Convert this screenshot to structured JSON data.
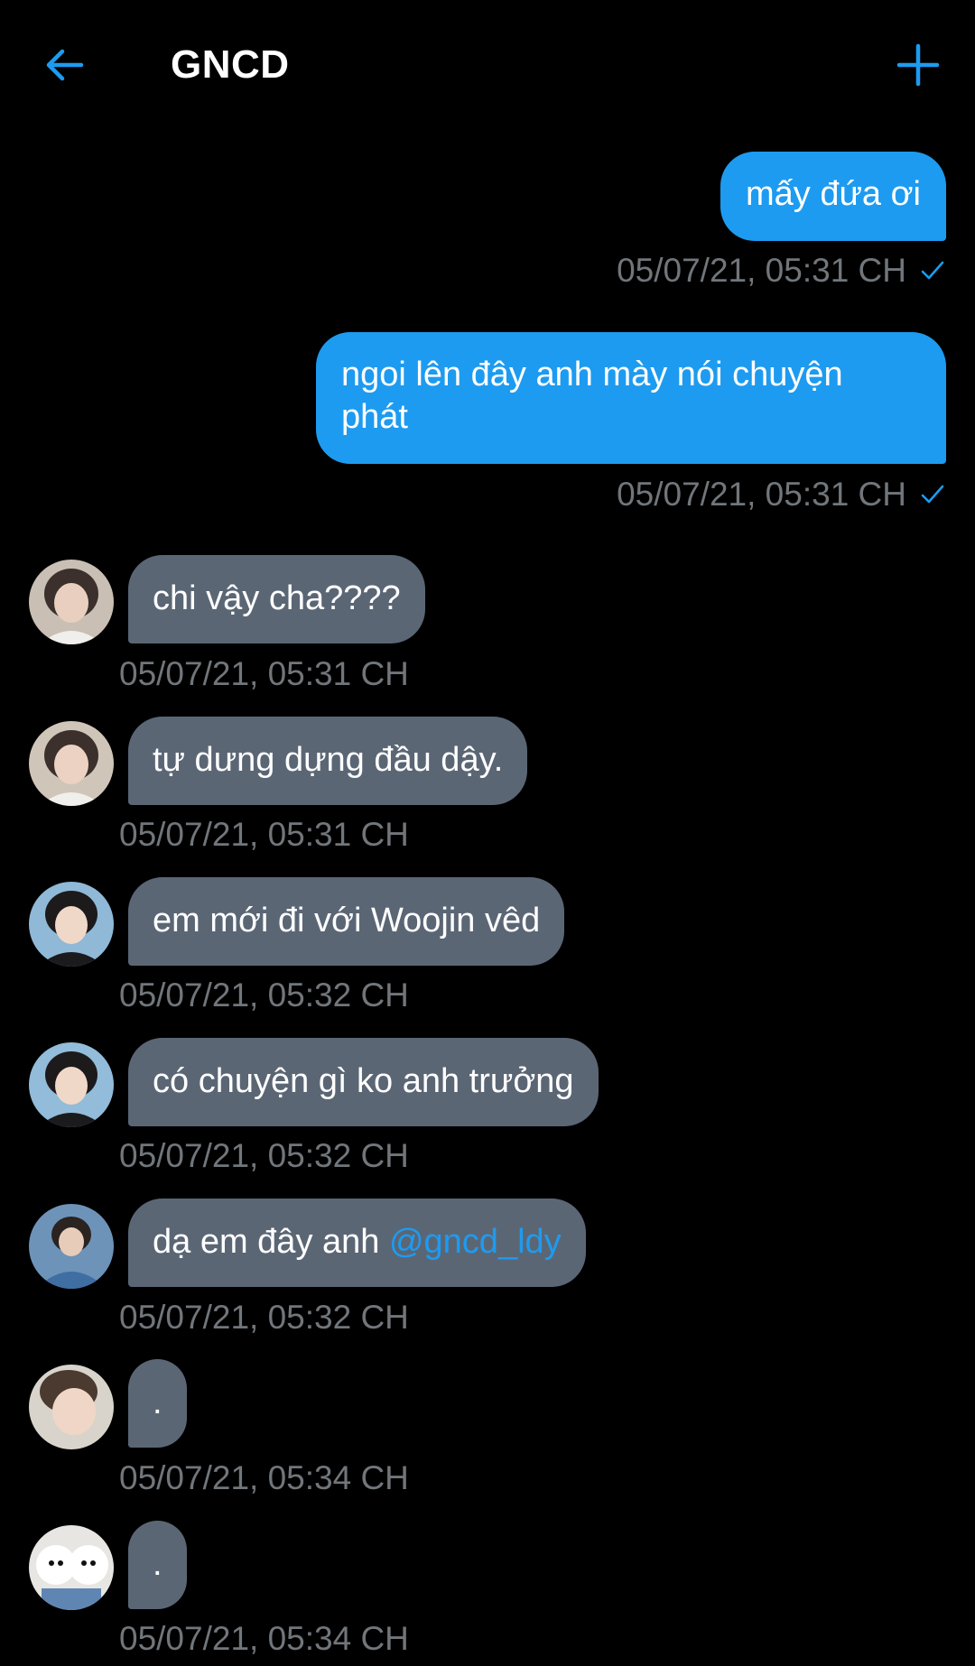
{
  "header": {
    "title": "GNCD",
    "back_icon": "arrow-left-icon",
    "add_icon": "plus-icon",
    "accent": "#1d9bf0"
  },
  "messages": [
    {
      "direction": "out",
      "text": "mấy đứa ơi",
      "time": "05/07/21, 05:31 CH",
      "status_icon": "check-icon"
    },
    {
      "direction": "out",
      "text_line1": "ngoi lên đây anh mày nói chuyện",
      "text_line2": "phát",
      "time": "05/07/21, 05:31 CH",
      "status_icon": "check-icon"
    },
    {
      "direction": "in",
      "text": "chi vậy cha????",
      "time": "05/07/21, 05:31 CH",
      "avatar": "avatar-boy-white-shirt"
    },
    {
      "direction": "in",
      "text": "tự dưng dựng đầu dậy.",
      "time": "05/07/21, 05:31 CH",
      "avatar": "avatar-boy-white-shirt"
    },
    {
      "direction": "in",
      "text": "em mới đi với Woojin vêd",
      "time": "05/07/21, 05:32 CH",
      "avatar": "avatar-boy-dark-jacket"
    },
    {
      "direction": "in",
      "text": "có chuyện gì ko anh trưởng",
      "time": "05/07/21, 05:32 CH",
      "avatar": "avatar-boy-dark-jacket"
    },
    {
      "direction": "in",
      "text_prefix": "dạ em đây anh ",
      "mention": "@gncd_ldy",
      "time": "05/07/21, 05:32 CH",
      "avatar": "avatar-boy-denim"
    },
    {
      "direction": "in",
      "text": ".",
      "time": "05/07/21, 05:34 CH",
      "avatar": "avatar-boy-closeup"
    },
    {
      "direction": "in",
      "text": ".",
      "time": "05/07/21, 05:34 CH",
      "avatar": "avatar-white-dogs"
    }
  ]
}
